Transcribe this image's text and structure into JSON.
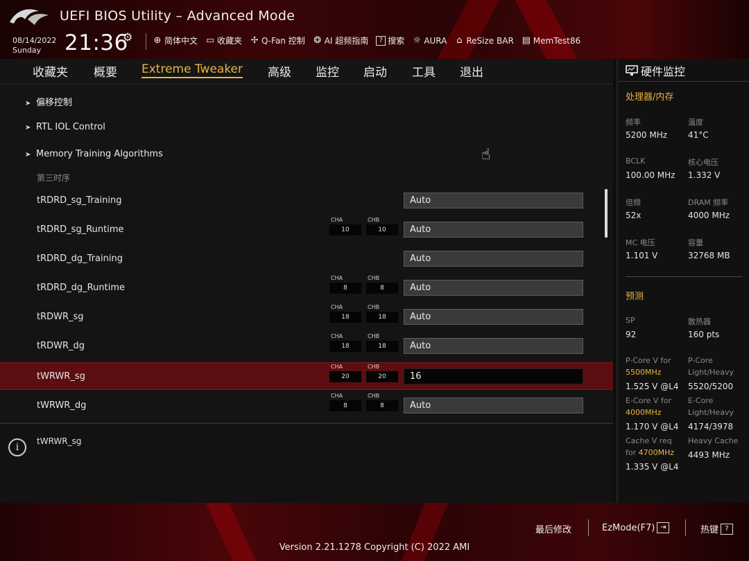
{
  "header": {
    "title": "UEFI BIOS Utility – Advanced Mode",
    "date": "08/14/2022",
    "day": "Sunday",
    "time": "21:36",
    "toolbar": [
      {
        "icon": "globe-icon",
        "glyph": "⊕",
        "label": "简体中文"
      },
      {
        "icon": "favorites-icon",
        "glyph": "▭",
        "label": "收藏夹"
      },
      {
        "icon": "fan-icon",
        "glyph": "✢",
        "label": "Q-Fan 控制"
      },
      {
        "icon": "ai-icon",
        "glyph": "❂",
        "label": "AI 超频指南"
      },
      {
        "icon": "search-icon",
        "glyph": "?",
        "label": "搜索"
      },
      {
        "icon": "aura-icon",
        "glyph": "☼",
        "label": "AURA"
      },
      {
        "icon": "resize-bar-icon",
        "glyph": "⌂",
        "label": "ReSize BAR"
      },
      {
        "icon": "memtest-icon",
        "glyph": "▤",
        "label": "MemTest86"
      }
    ]
  },
  "tabs": [
    "收藏夹",
    "概要",
    "Extreme Tweaker",
    "高级",
    "监控",
    "启动",
    "工具",
    "退出"
  ],
  "active_tab": "Extreme Tweaker",
  "submenus": [
    "偏移控制",
    "RTL IOL Control",
    "Memory Training Algorithms"
  ],
  "section_label": "第三时序",
  "settings": [
    {
      "label": "tRDRD_sg_Training",
      "value": "Auto"
    },
    {
      "label": "tRDRD_sg_Runtime",
      "cha_label": "CHA",
      "chb_label": "CHB",
      "cha": "10",
      "chb": "10",
      "value": "Auto"
    },
    {
      "label": "tRDRD_dg_Training",
      "value": "Auto"
    },
    {
      "label": "tRDRD_dg_Runtime",
      "cha_label": "CHA",
      "chb_label": "CHB",
      "cha": "8",
      "chb": "8",
      "value": "Auto"
    },
    {
      "label": "tRDWR_sg",
      "cha_label": "CHA",
      "chb_label": "CHB",
      "cha": "18",
      "chb": "18",
      "value": "Auto"
    },
    {
      "label": "tRDWR_dg",
      "cha_label": "CHA",
      "chb_label": "CHB",
      "cha": "18",
      "chb": "18",
      "value": "Auto"
    },
    {
      "label": "tWRWR_sg",
      "cha_label": "CHA",
      "chb_label": "CHB",
      "cha": "20",
      "chb": "20",
      "value": "16",
      "selected": true
    },
    {
      "label": "tWRWR_dg",
      "cha_label": "CHA",
      "chb_label": "CHB",
      "cha": "8",
      "chb": "8",
      "value": "Auto"
    }
  ],
  "help_text": "tWRWR_sg",
  "hw_monitor": {
    "title": "硬件监控",
    "cpu_section": "处理器/内存",
    "freq_label": "频率",
    "freq": "5200 MHz",
    "temp_label": "温度",
    "temp": "41°C",
    "bclk_label": "BCLK",
    "bclk": "100.00 MHz",
    "vcore_label": "核心电压",
    "vcore": "1.332 V",
    "ratio_label": "倍频",
    "ratio": "52x",
    "dram_freq_label": "DRAM 频率",
    "dram_freq": "4000 MHz",
    "mc_volt_label": "MC 电压",
    "mc_volt": "1.101 V",
    "capacity_label": "容量",
    "capacity": "32768 MB",
    "predict_section": "预测",
    "sp_label": "SP",
    "sp": "92",
    "cooler_label": "散热器",
    "cooler": "160 pts",
    "pcore_v_label": "P-Core V for",
    "pcore_v_freq": "5500MHz",
    "pcore_v": "1.525 V @L4",
    "pcore_lh_label1": "P-Core",
    "pcore_lh_label2": "Light/Heavy",
    "pcore_lh": "5520/5200",
    "ecore_v_label": "E-Core V for",
    "ecore_v_freq": "4000MHz",
    "ecore_v": "1.170 V @L4",
    "ecore_lh_label1": "E-Core",
    "ecore_lh_label2": "Light/Heavy",
    "ecore_lh": "4174/3978",
    "cache_v_label1": "Cache V req",
    "cache_v_label2": "for",
    "cache_v_freq": "4700MHz",
    "cache_v": "1.335 V @L4",
    "heavy_cache_label": "Heavy Cache",
    "heavy_cache": "4493 MHz"
  },
  "footer": {
    "last_modified": "最后修改",
    "ezmode": "EzMode(F7)",
    "ezmode_glyph": "⇥",
    "hotkeys": "热键",
    "hotkeys_glyph": "?",
    "version": "Version 2.21.1278 Copyright (C) 2022 AMI"
  },
  "colors": {
    "accent": "#e9b441",
    "selected_row": "#5c0e12",
    "brand_red": "#8a0a0e"
  }
}
